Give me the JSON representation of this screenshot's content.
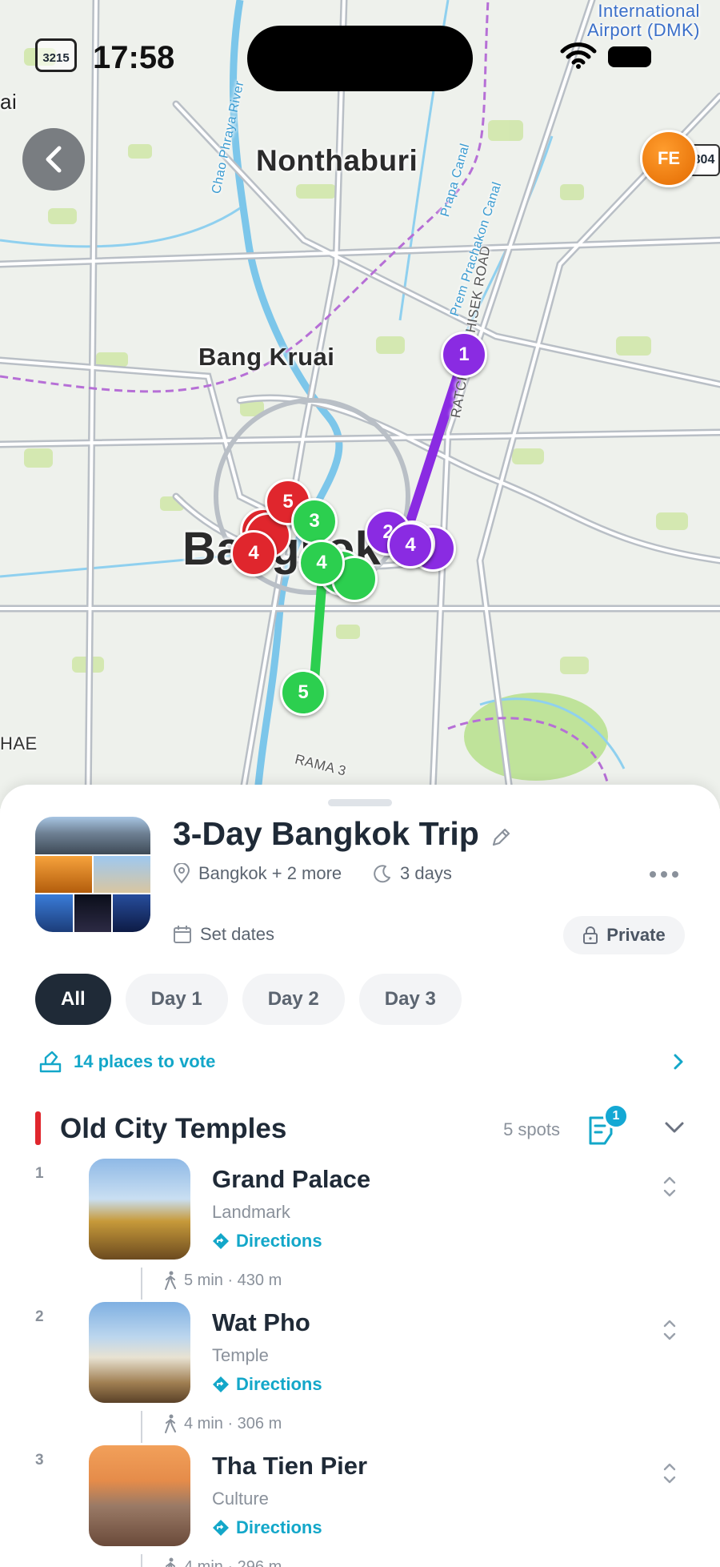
{
  "status_bar": {
    "time": "17:58",
    "carrier_badge": "3215"
  },
  "map": {
    "labels": {
      "nonthaburi": "Nonthaburi",
      "bang_kruai": "Bang Kruai",
      "bangkok": "Bangkok",
      "airport": "International\nAirport (DMK)",
      "left_edge": "ai",
      "left_edge2": "HAE",
      "ratchadaphisek": "RATCHADAPHISEK ROAD",
      "rama": "RAMA 3",
      "prem_prachakon": "Prem Prachakon Canal",
      "prapa": "Prapa Canal",
      "chao_phraya": "Chao Phraya River",
      "route_badge": "304"
    },
    "pins": {
      "p_purple_1": "1",
      "p_purple_2": "2",
      "p_purple_4": "4",
      "p_red_5": "5",
      "p_red_4": "4",
      "p_green_3": "3",
      "p_green_4": "4",
      "p_green_5": "5"
    },
    "colors": {
      "day1": "#e0262d",
      "day2": "#2ccf4f",
      "day3": "#8a2be2"
    },
    "avatar_initials": "FE"
  },
  "trip": {
    "title": "3-Day Bangkok Trip",
    "location": "Bangkok + 2 more",
    "duration": "3 days",
    "dates": "Set dates",
    "privacy": "Private"
  },
  "tabs": [
    "All",
    "Day 1",
    "Day 2",
    "Day 3"
  ],
  "vote": {
    "label": "14 places to vote"
  },
  "section": {
    "title": "Old City Temples",
    "spots": "5 spots",
    "notes_count": "1"
  },
  "places": [
    {
      "index": "1",
      "name": "Grand Palace",
      "category": "Landmark",
      "directions": "Directions",
      "walk": "5 min · 430 m"
    },
    {
      "index": "2",
      "name": "Wat Pho",
      "category": "Temple",
      "directions": "Directions",
      "walk": "4 min · 306 m"
    },
    {
      "index": "3",
      "name": "Tha Tien Pier",
      "category": "Culture",
      "directions": "Directions",
      "walk": "4 min · 296 m"
    }
  ]
}
